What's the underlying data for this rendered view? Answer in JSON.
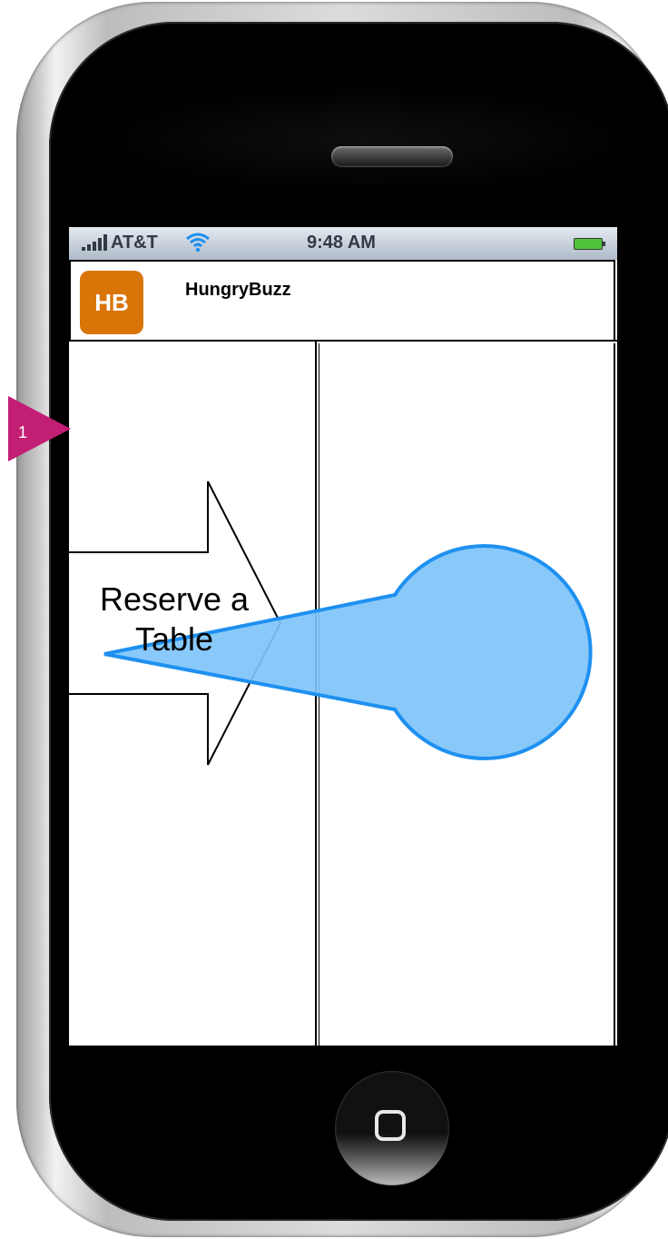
{
  "status_bar": {
    "carrier": "AT&T",
    "time": "9:48 AM"
  },
  "header": {
    "logo_text": "HB",
    "title": "HungryBuzz"
  },
  "main": {
    "action_label": "Reserve a Table"
  },
  "annotation": {
    "marker_number": "1"
  },
  "icons": {
    "signal": "signal-bars-icon",
    "wifi": "wifi-icon",
    "battery": "battery-icon",
    "home": "home-button-icon",
    "arrow": "right-arrow-icon",
    "pointer": "callout-pointer-icon"
  },
  "colors": {
    "logo_bg": "#d97408",
    "callout_fill": "#7ec4fa",
    "callout_stroke": "#1e90f0",
    "marker": "#c21f74",
    "battery": "#4ec53a"
  }
}
